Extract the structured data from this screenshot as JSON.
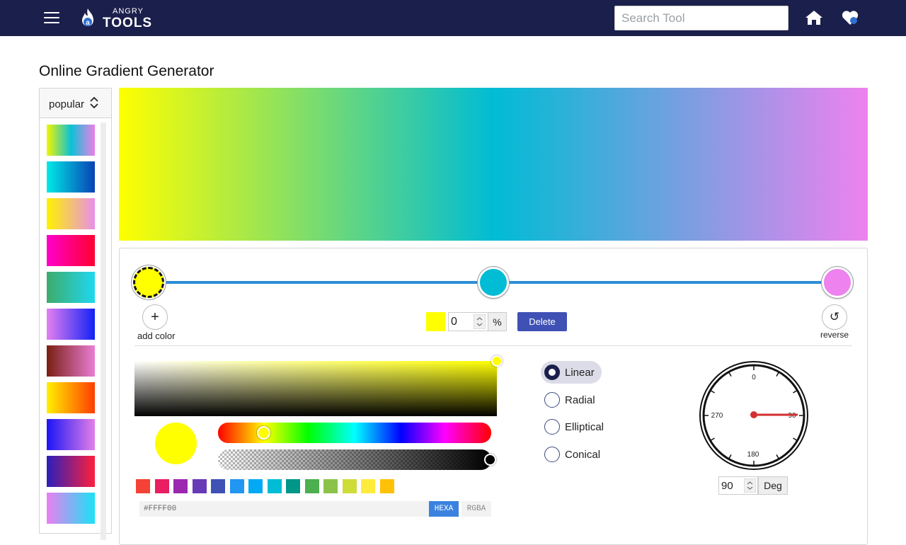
{
  "header": {
    "logo_small": "ANGRY",
    "logo_big": "TOOLS",
    "search_placeholder": "Search Tool"
  },
  "page": {
    "title": "Online Gradient Generator"
  },
  "sidebar": {
    "dropdown_label": "popular",
    "presets": [
      {
        "colors": [
          "#f2f600",
          "#0bc2d5",
          "#ec7fe8"
        ]
      },
      {
        "colors": [
          "#00eae6",
          "#0a42b5"
        ]
      },
      {
        "colors": [
          "#fff200",
          "#e88fe8"
        ]
      },
      {
        "colors": [
          "#ff00cc",
          "#ff0030"
        ]
      },
      {
        "colors": [
          "#3eab6a",
          "#1fd8f0"
        ]
      },
      {
        "colors": [
          "#e47ff0",
          "#1222f5"
        ]
      },
      {
        "colors": [
          "#7a1f12",
          "#ea7ed5"
        ]
      },
      {
        "colors": [
          "#fff000",
          "#ff3d00"
        ]
      },
      {
        "colors": [
          "#1b15f5",
          "#e47fe8"
        ]
      },
      {
        "colors": [
          "#2a1fbb",
          "#ff1f3d"
        ]
      },
      {
        "colors": [
          "#ea7ff0",
          "#1ae2f5"
        ]
      }
    ]
  },
  "gradient": {
    "type": "linear",
    "angle_deg": 90,
    "stops": [
      {
        "color": "#FFFF00",
        "position": 0,
        "active": true
      },
      {
        "color": "#00BCD4",
        "position": 50,
        "active": false
      },
      {
        "color": "#EE82EE",
        "position": 100,
        "active": false
      }
    ]
  },
  "stop_controls": {
    "add_label": "add color",
    "reverse_label": "reverse",
    "position_value": "0",
    "percent_label": "%",
    "delete_label": "Delete"
  },
  "picker": {
    "hex_value": "#FFFF00",
    "hexa_label": "HEXA",
    "rgba_label": "RGBA",
    "palette": [
      "#f44336",
      "#e91e63",
      "#9c27b0",
      "#673ab7",
      "#3f51b5",
      "#2196f3",
      "#03a9f4",
      "#00bcd4",
      "#009688",
      "#4caf50",
      "#8bc34a",
      "#cddc39",
      "#ffeb3b",
      "#ffc107"
    ]
  },
  "types": {
    "options": [
      "Linear",
      "Radial",
      "Elliptical",
      "Conical"
    ],
    "selected": "Linear"
  },
  "angle": {
    "value": "90",
    "unit_label": "Deg",
    "dial_labels": {
      "top": "0",
      "right": "90",
      "bottom": "180",
      "left": "270"
    }
  }
}
